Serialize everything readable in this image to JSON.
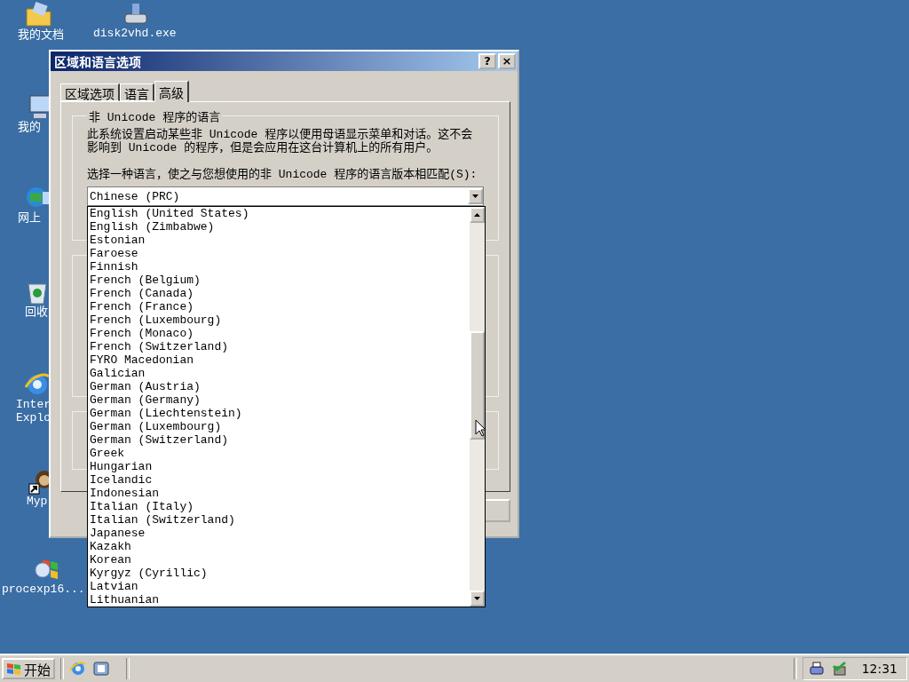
{
  "desktop_icons": [
    {
      "kind": "folder",
      "lines": [
        "我的文档"
      ]
    },
    {
      "kind": "installer",
      "lines": [
        "disk2vhd.exe"
      ]
    },
    {
      "kind": "computer",
      "lines": [
        "我的"
      ]
    },
    {
      "kind": "network",
      "lines": [
        "网上"
      ]
    },
    {
      "kind": "recycle",
      "lines": [
        "回收"
      ]
    },
    {
      "kind": "browser",
      "lines": [
        "Inter",
        "Explo"
      ]
    },
    {
      "kind": "shortcut",
      "lines": [
        "Myp"
      ]
    },
    {
      "kind": "app",
      "lines": [
        "procexp16..."
      ]
    }
  ],
  "dialog": {
    "title": "区域和语言选项",
    "help_button": "?",
    "close_button": "×",
    "tabs": [
      {
        "label": "区域选项",
        "selected": false
      },
      {
        "label": "语言",
        "selected": false
      },
      {
        "label": "高级",
        "selected": true
      }
    ],
    "group": {
      "title": "非 Unicode 程序的语言",
      "description": "此系统设置启动某些非 Unicode 程序以便用母语显示菜单和对话。这不会影响到 Unicode 的程序，但是会应用在这台计算机上的所有用户。",
      "prompt": "选择一种语言，使之与您想使用的非 Unicode 程序的语言版本相匹配(S):",
      "combo_value": "Chinese (PRC)",
      "options": [
        "English (United States)",
        "English (Zimbabwe)",
        "Estonian",
        "Faroese",
        "Finnish",
        "French (Belgium)",
        "French (Canada)",
        "French (France)",
        "French (Luxembourg)",
        "French (Monaco)",
        "French (Switzerland)",
        "FYRO Macedonian",
        "Galician",
        "German (Austria)",
        "German (Germany)",
        "German (Liechtenstein)",
        "German (Luxembourg)",
        "German (Switzerland)",
        "Greek",
        "Hungarian",
        "Icelandic",
        "Indonesian",
        "Italian (Italy)",
        "Italian (Switzerland)",
        "Japanese",
        "Kazakh",
        "Korean",
        "Kyrgyz (Cyrillic)",
        "Latvian",
        "Lithuanian"
      ]
    }
  },
  "taskbar": {
    "start": "开始",
    "clock": "12:31"
  }
}
